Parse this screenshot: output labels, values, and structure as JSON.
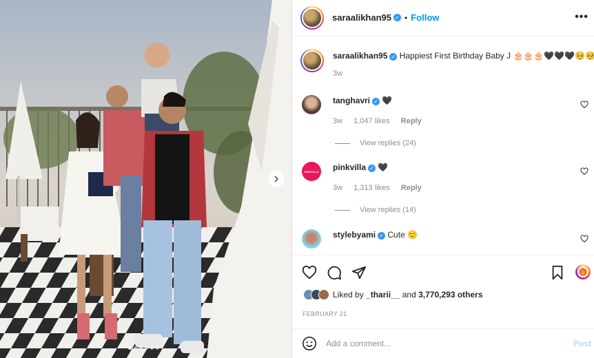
{
  "post": {
    "photo_alt": "",
    "carousel_dots": 6,
    "carousel_active": 0
  },
  "header": {
    "username": "saraalikhan95",
    "separator": "•",
    "follow_label": "Follow",
    "more_label": "•••"
  },
  "caption": {
    "username": "saraalikhan95",
    "text": "Happiest First Birthday Baby J 🎂🎂🎂🖤🖤🖤🥺🥺🥺",
    "time": "3w"
  },
  "comments": [
    {
      "username": "tanghavri",
      "text": "🖤",
      "time": "3w",
      "likes": "1,047 likes",
      "reply_label": "Reply",
      "view_replies": "View replies (24)",
      "avatar_color": "#5a3a30"
    },
    {
      "username": "pinkvilla",
      "text": "🖤",
      "time": "3w",
      "likes": "1,313 likes",
      "reply_label": "Reply",
      "view_replies": "View replies (14)",
      "avatar_color": "#e8185a",
      "avatar_text": "PINKVILLA"
    },
    {
      "username": "stylebyami",
      "text": "Cute 🙂",
      "avatar_color": "#7fd3e0"
    }
  ],
  "likes": {
    "prefix": "Liked by",
    "user": "_tharii__",
    "joiner": "and",
    "count": "3,770,293 others"
  },
  "date": "FEBRUARY 21",
  "add_comment": {
    "placeholder": "Add a comment...",
    "post_label": "Post"
  },
  "colors": {
    "accent": "#0095f6",
    "verified": "#3897f0",
    "muted": "#8e8e8e",
    "post_disabled": "#b3dbff"
  },
  "icons": [
    "chevron-right-icon",
    "verified-icon",
    "more-icon",
    "heart-icon",
    "comment-icon",
    "share-icon",
    "bookmark-icon",
    "download-icon",
    "emoji-icon"
  ]
}
